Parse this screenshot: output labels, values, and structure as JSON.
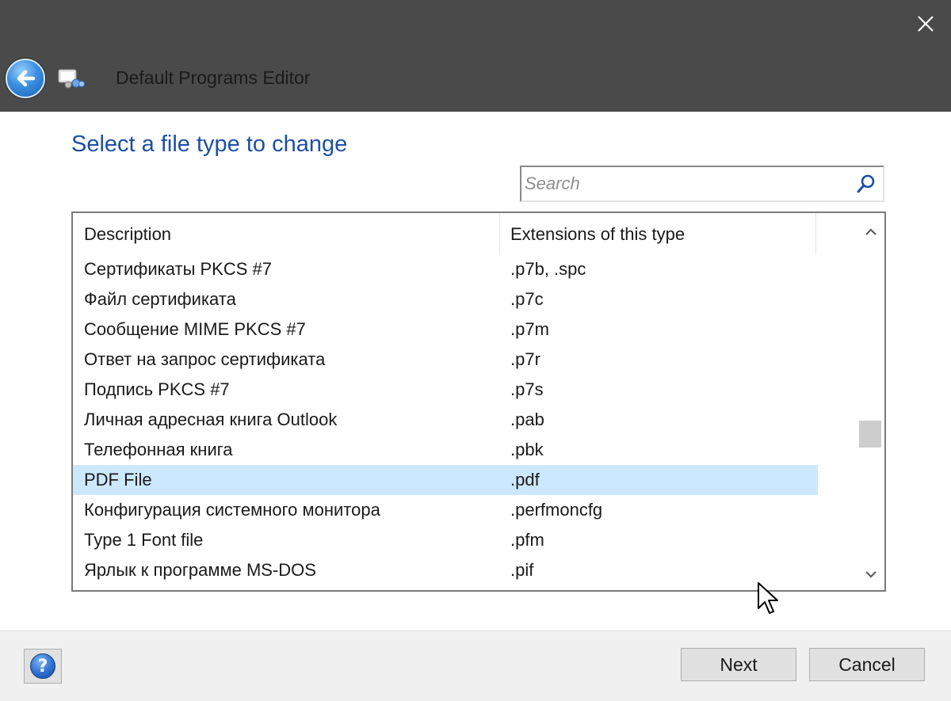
{
  "window": {
    "title": "Default Programs Editor",
    "close_icon": "close-icon",
    "back_icon": "back-arrow-icon",
    "app_icon": "default-programs-editor-icon"
  },
  "main": {
    "heading": "Select a file type to change",
    "search": {
      "placeholder": "Search",
      "value": "",
      "icon": "search-icon"
    }
  },
  "list": {
    "columns": [
      "Description",
      "Extensions of this type"
    ],
    "rows": [
      {
        "description": "Сертификаты PKCS #7",
        "extensions": ".p7b, .spc",
        "selected": false
      },
      {
        "description": "Файл сертификата",
        "extensions": ".p7c",
        "selected": false
      },
      {
        "description": "Сообщение MIME PKCS #7",
        "extensions": ".p7m",
        "selected": false
      },
      {
        "description": "Ответ на запрос сертификата",
        "extensions": ".p7r",
        "selected": false
      },
      {
        "description": "Подпись PKCS #7",
        "extensions": ".p7s",
        "selected": false
      },
      {
        "description": "Личная адресная книга Outlook",
        "extensions": ".pab",
        "selected": false
      },
      {
        "description": "Телефонная книга",
        "extensions": ".pbk",
        "selected": false
      },
      {
        "description": "PDF File",
        "extensions": ".pdf",
        "selected": true
      },
      {
        "description": "Конфигурация системного монитора",
        "extensions": ".perfmoncfg",
        "selected": false
      },
      {
        "description": "Type 1 Font file",
        "extensions": ".pfm",
        "selected": false
      },
      {
        "description": "Ярлык к программе MS-DOS",
        "extensions": ".pif",
        "selected": false
      }
    ],
    "selected_color": "#cce8ff"
  },
  "footer": {
    "help_label": "?",
    "next_label": "Next",
    "cancel_label": "Cancel"
  },
  "colors": {
    "titlebar": "#4a4a4a",
    "heading": "#1c4fa8",
    "selection": "#cce8ff"
  }
}
